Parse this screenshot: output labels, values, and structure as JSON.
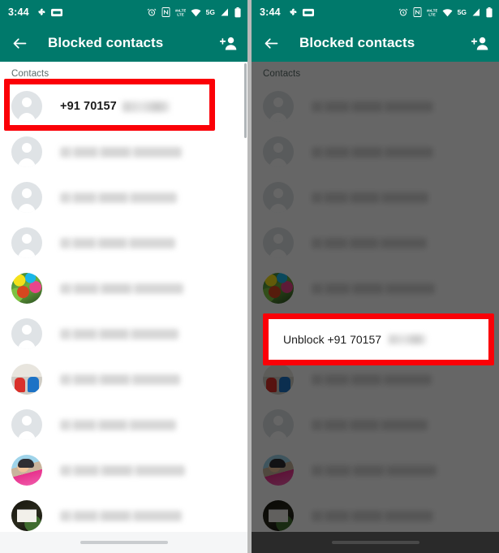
{
  "app": {
    "screens": [
      {
        "id": "blocked-contacts-list",
        "statusbar": {
          "time": "3:44",
          "left_icons": [
            "pinwheel-app-icon",
            "wallet-app-icon"
          ],
          "right_icons": [
            "alarm-icon",
            "nfc-icon",
            "volte-icon",
            "wifi-icon",
            "signal-icon",
            "battery-icon"
          ],
          "network_label": "5G"
        },
        "appbar": {
          "back_icon": "back-arrow-icon",
          "title": "Blocked contacts",
          "action_icon": "add-person-icon"
        },
        "section_label": "Contacts",
        "rows": [
          {
            "avatar": "default",
            "text": "+91 70157",
            "redacted": true,
            "highlighted": true
          },
          {
            "avatar": "default",
            "text": "",
            "blurred": true
          },
          {
            "avatar": "default",
            "text": "",
            "blurred": true
          },
          {
            "avatar": "default",
            "text": "",
            "blurred": true
          },
          {
            "avatar": "photo-1",
            "text": "",
            "blurred": true
          },
          {
            "avatar": "default",
            "text": "",
            "blurred": true
          },
          {
            "avatar": "photo-2",
            "text": "",
            "blurred": true
          },
          {
            "avatar": "default",
            "text": "",
            "blurred": true
          },
          {
            "avatar": "photo-3",
            "text": "",
            "blurred": true
          },
          {
            "avatar": "photo-4",
            "text": "",
            "blurred": true
          }
        ],
        "dimmed": false,
        "dialog": null
      },
      {
        "id": "unblock-confirmation",
        "statusbar": {
          "time": "3:44",
          "left_icons": [
            "pinwheel-app-icon",
            "wallet-app-icon"
          ],
          "right_icons": [
            "alarm-icon",
            "nfc-icon",
            "volte-icon",
            "wifi-icon",
            "signal-icon",
            "battery-icon"
          ],
          "network_label": "5G"
        },
        "appbar": {
          "back_icon": "back-arrow-icon",
          "title": "Blocked contacts",
          "action_icon": "add-person-icon"
        },
        "section_label": "Contacts",
        "rows": [
          {
            "avatar": "default",
            "text": "",
            "blurred": true
          },
          {
            "avatar": "default",
            "text": "",
            "blurred": true
          },
          {
            "avatar": "default",
            "text": "",
            "blurred": true
          },
          {
            "avatar": "default",
            "text": "",
            "blurred": true
          },
          {
            "avatar": "photo-1",
            "text": "",
            "blurred": true
          },
          {
            "avatar": "default",
            "text": "",
            "blurred": true
          },
          {
            "avatar": "photo-2",
            "text": "",
            "blurred": true
          },
          {
            "avatar": "default",
            "text": "",
            "blurred": true
          },
          {
            "avatar": "photo-3",
            "text": "",
            "blurred": true
          },
          {
            "avatar": "photo-4",
            "text": "",
            "blurred": true
          }
        ],
        "dimmed": true,
        "dialog": {
          "label": "Unblock +91 70157",
          "redacted": true,
          "highlighted": true
        }
      }
    ],
    "colors": {
      "header": "#00796b",
      "highlight": "#fb0007",
      "page_background": "#ffffff",
      "scrim": "rgba(0,0,0,0.60)",
      "avatar_placeholder": "#dfe3e6",
      "section_label": "#5a6b6a"
    }
  }
}
